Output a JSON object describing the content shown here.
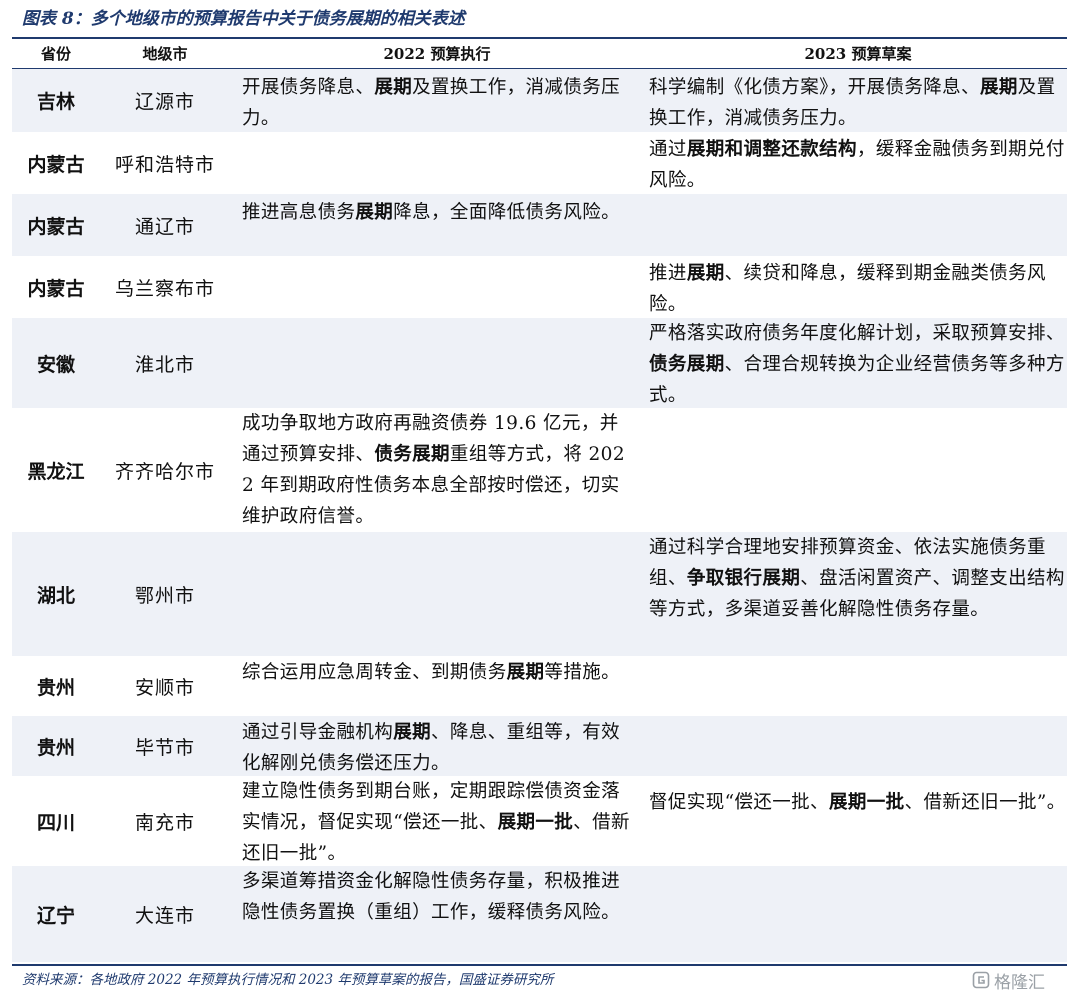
{
  "figure": {
    "title": "图表 8：多个地级市的预算报告中关于债务展期的相关表述",
    "source": "资料来源：各地政府 2022 年预算执行情况和 2023 年预算草案的报告，国盛证券研究所",
    "watermark": "格隆汇"
  },
  "table": {
    "headers": {
      "province": "省份",
      "city": "地级市",
      "y2022": "2022 预算执行",
      "y2023": "2023 预算草案"
    },
    "rows": [
      {
        "province": "吉林",
        "city": "辽源市",
        "y2022": [
          {
            "t": "开展债务降息、"
          },
          {
            "t": "展期",
            "b": true
          },
          {
            "t": "及置换工作，消减债务压力。"
          }
        ],
        "y2023": [
          {
            "t": "科学编制《化债方案》，开展债务降息、"
          },
          {
            "t": "展期",
            "b": true
          },
          {
            "t": "及置换工作，消减债务压力。"
          }
        ]
      },
      {
        "province": "内蒙古",
        "city": "呼和浩特市",
        "y2022": [],
        "y2023": [
          {
            "t": "通过"
          },
          {
            "t": "展期和调整还款结构",
            "b": true
          },
          {
            "t": "，缓释金融债务到期兑付风险。"
          }
        ]
      },
      {
        "province": "内蒙古",
        "city": "通辽市",
        "y2022": [
          {
            "t": "推进高息债务"
          },
          {
            "t": "展期",
            "b": true
          },
          {
            "t": "降息，全面降低债务风险。"
          }
        ],
        "y2023": []
      },
      {
        "province": "内蒙古",
        "city": "乌兰察布市",
        "y2022": [],
        "y2023": [
          {
            "t": "推进"
          },
          {
            "t": "展期",
            "b": true
          },
          {
            "t": "、续贷和降息，缓释到期金融类债务风险。"
          }
        ]
      },
      {
        "province": "安徽",
        "city": "淮北市",
        "y2022": [],
        "y2023": [
          {
            "t": "严格落实政府债务年度化解计划，采取预算安排、"
          },
          {
            "t": "债务展期",
            "b": true
          },
          {
            "t": "、合理合规转换为企业经营债务等多种方式。"
          }
        ]
      },
      {
        "province": "黑龙江",
        "city": "齐齐哈尔市",
        "y2022": [
          {
            "t": "成功争取地方政府再融资债券 19.6 亿元，并通过预算安排、"
          },
          {
            "t": "债务展期",
            "b": true
          },
          {
            "t": "重组等方式，将 2022 年到期政府性债务本息全部按时偿还，切实维护政府信誉。"
          }
        ],
        "y2023": []
      },
      {
        "province": "湖北",
        "city": "鄂州市",
        "y2022": [],
        "y2023": [
          {
            "t": "通过科学合理地安排预算资金、依法实施债务重组、"
          },
          {
            "t": "争取银行展期",
            "b": true
          },
          {
            "t": "、盘活闲置资产、调整支出结构等方式，多渠道妥善化解隐性债务存量。"
          }
        ]
      },
      {
        "province": "贵州",
        "city": "安顺市",
        "y2022": [
          {
            "t": "综合运用应急周转金、到期债务"
          },
          {
            "t": "展期",
            "b": true
          },
          {
            "t": "等措施。"
          }
        ],
        "y2023": []
      },
      {
        "province": "贵州",
        "city": "毕节市",
        "y2022": [
          {
            "t": "通过引导金融机构"
          },
          {
            "t": "展期",
            "b": true
          },
          {
            "t": "、降息、重组等，有效化解刚兑债务偿还压力。"
          }
        ],
        "y2023": []
      },
      {
        "province": "四川",
        "city": "南充市",
        "y2022": [
          {
            "t": "建立隐性债务到期台账，定期跟踪偿债资金落实情况，督促实现“偿还一批、"
          },
          {
            "t": "展期一批",
            "b": true
          },
          {
            "t": "、借新还旧一批”。"
          }
        ],
        "y2023": [
          {
            "t": "督促实现“偿还一批、"
          },
          {
            "t": "展期一批",
            "b": true
          },
          {
            "t": "、借新还旧一批”。"
          }
        ]
      },
      {
        "province": "辽宁",
        "city": "大连市",
        "y2022": [
          {
            "t": "多渠道筹措资金化解隐性债务存量，积极推进隐性债务置换（重组）工作，缓释债务风险。"
          }
        ],
        "y2023": []
      }
    ]
  }
}
